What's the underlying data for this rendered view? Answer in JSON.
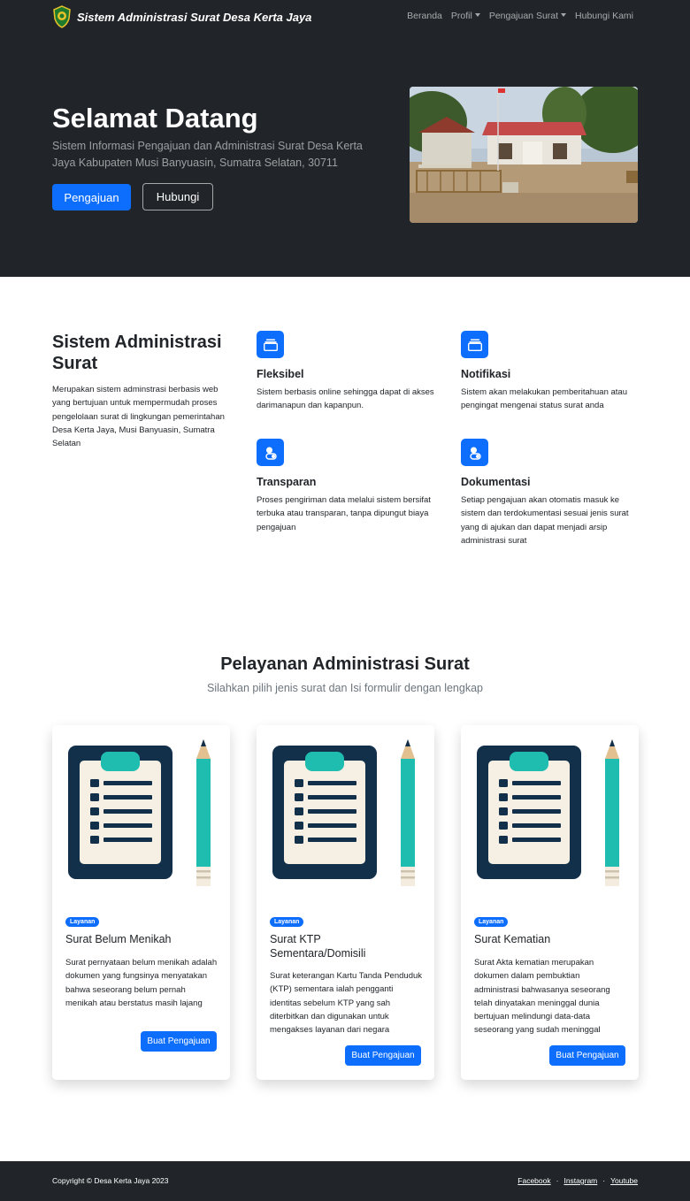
{
  "navbar": {
    "brand": "Sistem Administrasi Surat Desa Kerta Jaya",
    "links": [
      "Beranda",
      "Profil",
      "Pengajuan Surat",
      "Hubungi Kami"
    ]
  },
  "hero": {
    "title": "Selamat Datang",
    "lead": "Sistem Informasi Pengajuan dan Administrasi Surat Desa Kerta Jaya Kabupaten Musi Banyuasin, Sumatra Selatan, 30711",
    "primary_button": "Pengajuan",
    "secondary_button": "Hubungi"
  },
  "features": {
    "title": "Sistem Administrasi Surat",
    "description": "Merupakan sistem adminstrasi berbasis web yang bertujuan untuk mempermudah proses pengelolaan surat di lingkungan pemerintahan Desa Kerta Jaya, Musi Banyuasin, Sumatra Selatan",
    "items": [
      {
        "name": "Fleksibel",
        "text": "Sistem berbasis online sehingga dapat di akses darimanapun dan kapanpun."
      },
      {
        "name": "Notifikasi",
        "text": "Sistem akan melakukan pemberitahuan atau pengingat mengenai status surat anda"
      },
      {
        "name": "Transparan",
        "text": "Proses pengiriman data melalui sistem bersifat terbuka atau transparan, tanpa dipungut biaya pengajuan"
      },
      {
        "name": "Dokumentasi",
        "text": "Setiap pengajuan akan otomatis masuk ke sistem dan terdokumentasi sesuai jenis surat yang di ajukan dan dapat menjadi arsip administrasi surat"
      }
    ]
  },
  "services": {
    "title": "Pelayanan Administrasi Surat",
    "lead": "Silahkan pilih jenis surat dan Isi formulir dengan lengkap",
    "cards": [
      {
        "badge": "Layanan",
        "title": "Surat Belum Menikah",
        "text": "Surat pernyataan belum menikah adalah dokumen yang fungsinya menyatakan bahwa seseorang belum pernah menikah atau berstatus masih lajang",
        "button": "Buat Pengajuan"
      },
      {
        "badge": "Layanan",
        "title": "Surat KTP Sementara/Domisili",
        "text": "Surat keterangan Kartu Tanda Penduduk (KTP) sementara ialah pengganti identitas sebelum KTP yang sah diterbitkan dan digunakan untuk mengakses layanan dari negara",
        "button": "Buat Pengajuan"
      },
      {
        "badge": "Layanan",
        "title": "Surat Kematian",
        "text": "Surat Akta kematian merupakan dokumen dalam pembuktian administrasi bahwasanya seseorang telah dinyatakan meninggal dunia bertujuan melindungi data-data seseorang yang sudah meninggal",
        "button": "Buat Pengajuan"
      }
    ]
  },
  "footer": {
    "copyright": "Copyright © Desa Kerta Jaya 2023",
    "links": [
      "Facebook",
      "Instagram",
      "Youtube"
    ],
    "separator": "·"
  },
  "colors": {
    "primary": "#0d6efd",
    "dark": "#212529",
    "muted": "#6c757d"
  }
}
